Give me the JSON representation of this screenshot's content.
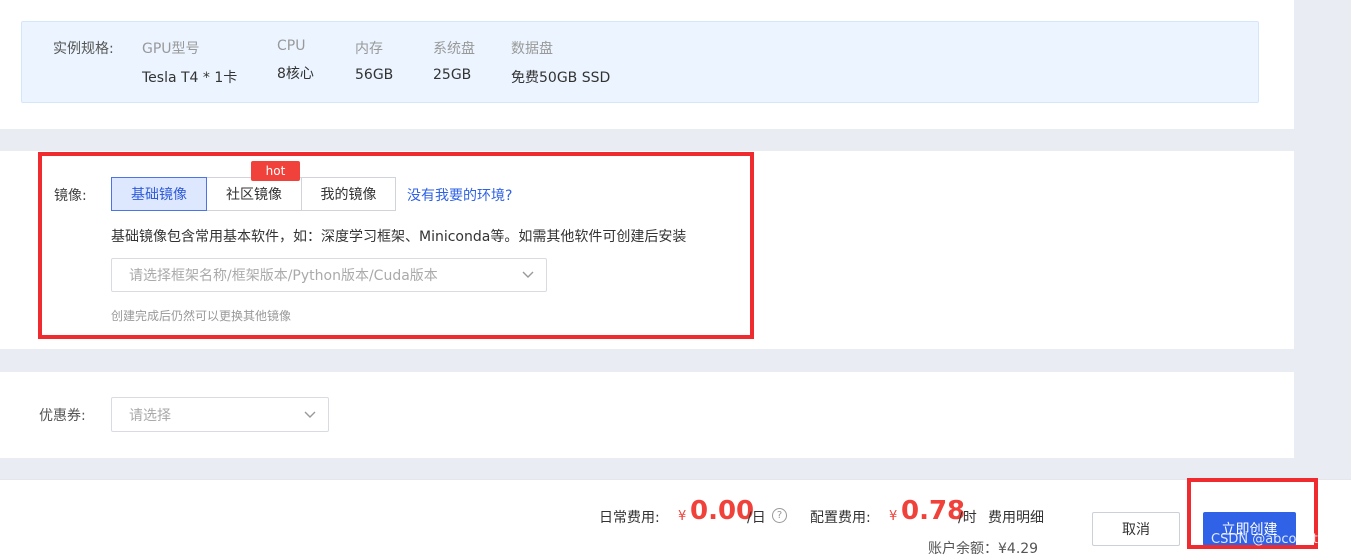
{
  "spec": {
    "label": "实例规格:",
    "columns": [
      {
        "header": "GPU型号",
        "value": "Tesla T4 * 1卡"
      },
      {
        "header": "CPU",
        "value": "8核心"
      },
      {
        "header": "内存",
        "value": "56GB"
      },
      {
        "header": "系统盘",
        "value": "25GB"
      },
      {
        "header": "数据盘",
        "value": "免费50GB SSD"
      }
    ]
  },
  "image": {
    "label": "镜像:",
    "tabs": [
      {
        "label": "基础镜像",
        "active": true
      },
      {
        "label": "社区镜像",
        "active": false
      },
      {
        "label": "我的镜像",
        "active": false
      }
    ],
    "hot_badge": "hot",
    "missing_env_link": "没有我要的环境?",
    "description": "基础镜像包含常用基本软件，如：深度学习框架、Miniconda等。如需其他软件可创建后安装",
    "select_placeholder": "请选择框架名称/框架版本/Python版本/Cuda版本",
    "hint": "创建完成后仍然可以更换其他镜像"
  },
  "coupon": {
    "label": "优惠券:",
    "select_placeholder": "请选择"
  },
  "billing": {
    "daily_label": "日常费用:",
    "currency": "¥",
    "daily_price": "0.00",
    "daily_unit": "/日",
    "help": "?",
    "config_label": "配置费用:",
    "config_price": "0.78",
    "config_unit": "/时",
    "detail_link": "费用明细",
    "balance_text": "账户余额：¥4.29"
  },
  "actions": {
    "cancel_label": "取消",
    "create_label": "立即创建"
  },
  "watermark": "CSDN @abcobatqw",
  "colors": {
    "primary": "#2f62e6",
    "price_red": "#f0413a",
    "annotation_red": "#ef2b2f",
    "spec_bg": "#ecf5ff"
  }
}
